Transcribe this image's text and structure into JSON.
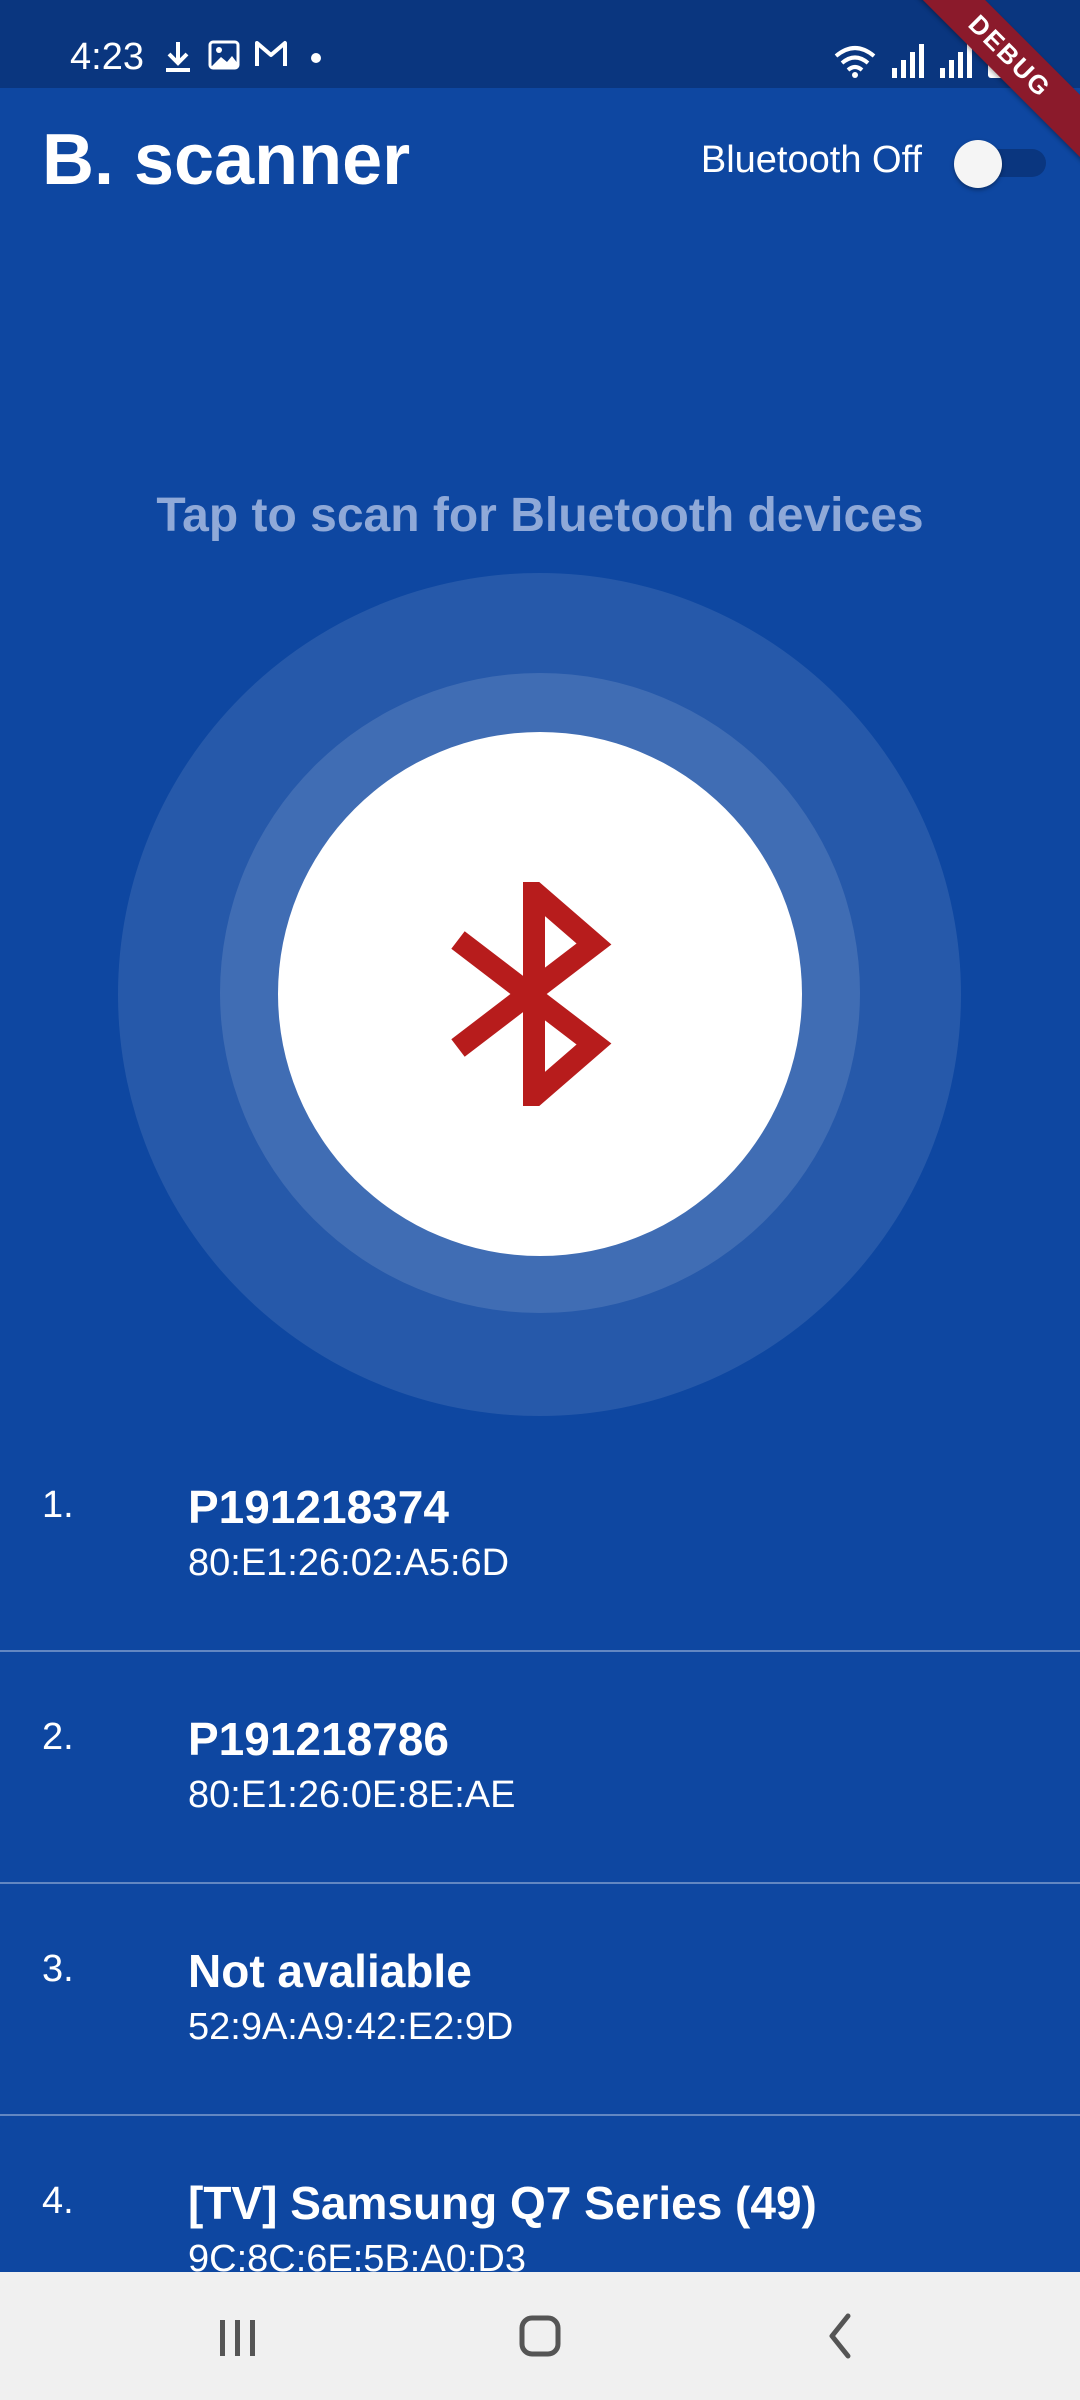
{
  "status_bar": {
    "time": "4:23",
    "icons": [
      "download-icon",
      "image-icon",
      "gmail-icon",
      "dot-icon",
      "wifi-icon",
      "signal-icon",
      "signal-icon",
      "battery-icon"
    ]
  },
  "debug_banner": "DEBUG",
  "app_bar": {
    "title": "B. scanner",
    "bluetooth_label": "Bluetooth Off",
    "bluetooth_enabled": false
  },
  "scan": {
    "hint": "Tap to scan for Bluetooth devices",
    "icon": "bluetooth-icon",
    "icon_color": "#b71c1c"
  },
  "devices": [
    {
      "index": "1.",
      "name": "P191218374",
      "address": "80:E1:26:02:A5:6D"
    },
    {
      "index": "2.",
      "name": "P191218786",
      "address": "80:E1:26:0E:8E:AE"
    },
    {
      "index": "3.",
      "name": "Not avaliable",
      "address": "52:9A:A9:42:E2:9D"
    },
    {
      "index": "4.",
      "name": "[TV] Samsung Q7 Series (49)",
      "address": "9C:8C:6E:5B:A0:D3"
    }
  ],
  "nav_bar": {
    "buttons": [
      "recents-icon",
      "home-icon",
      "back-icon"
    ]
  },
  "colors": {
    "background": "#0e47a1",
    "status_bar": "#0a367f",
    "bluetooth_icon": "#b71c1c",
    "hint_text": "#8fa9d8"
  }
}
